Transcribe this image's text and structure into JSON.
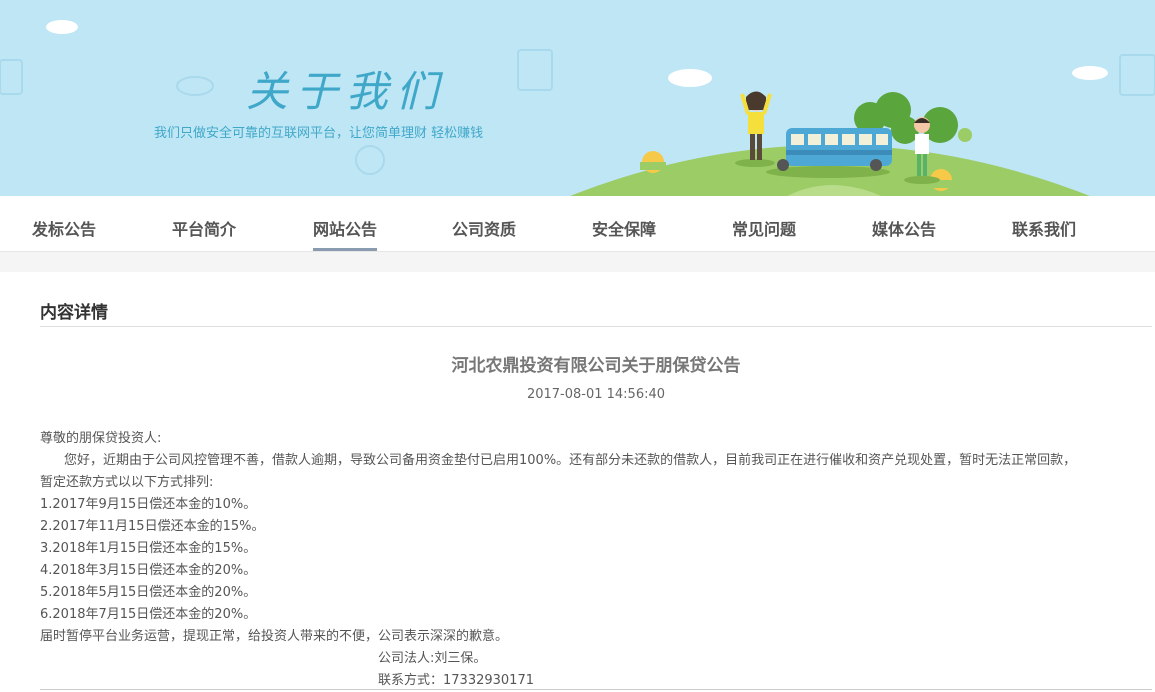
{
  "banner": {
    "title": "关于我们",
    "slogan": "我们只做安全可靠的互联网平台，让您简单理财 轻松赚钱"
  },
  "nav": {
    "items": [
      {
        "label": "发标公告"
      },
      {
        "label": "平台简介"
      },
      {
        "label": "网站公告",
        "active": true
      },
      {
        "label": "公司资质"
      },
      {
        "label": "安全保障"
      },
      {
        "label": "常见问题"
      },
      {
        "label": "媒体公告"
      },
      {
        "label": "联系我们"
      }
    ]
  },
  "content": {
    "section_title": "内容详情",
    "article_title": "河北农鼎投资有限公司关于朋保贷公告",
    "date": "2017-08-01 14:56:40",
    "greeting": "尊敬的朋保贷投资人:",
    "paragraph": "您好，近期由于公司风控管理不善，借款人逾期，导致公司备用资金垫付已启用100%。还有部分未还款的借款人，目前我司正在进行催收和资产兑现处置，暂时无法正常回款，",
    "paragraph_cont": "暂定还款方式以以下方式排列:",
    "schedule": [
      "1.2017年9月15日偿还本金的10%。",
      "2.2017年11月15日偿还本金的15%。",
      "3.2018年1月15日偿还本金的15%。",
      "4.2018年3月15日偿还本金的20%。",
      "5.2018年5月15日偿还本金的20%。",
      "6.2018年7月15日偿还本金的20%。"
    ],
    "closing": "届时暂停平台业务运营，提现正常，给投资人带来的不便，公司表示深深的歉意。",
    "legal_person": "公司法人:刘三保。",
    "contact": "联系方式：17332930171"
  },
  "colors": {
    "banner_bg": "#bfe6f5",
    "accent": "#3fa8c9",
    "hill": "#9ccc65"
  }
}
